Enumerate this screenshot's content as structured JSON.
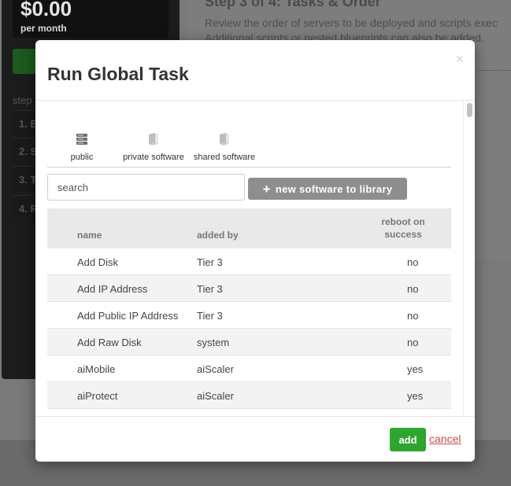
{
  "background": {
    "price": "$0.00",
    "price_period": "per month",
    "steps_label": "step",
    "steps": [
      "1. E",
      "2. S",
      "3. T",
      "4. R"
    ],
    "heading": "Step 3 of 4: Tasks & Order",
    "description_line1": "Review the order of servers to be deployed and scripts exec",
    "description_line2": "Additional scripts or nested blueprints can also be added."
  },
  "modal": {
    "title": "Run Global Task",
    "close_glyph": "×",
    "tabs": [
      {
        "label": "public",
        "icon": "server-stack-icon"
      },
      {
        "label": "private software",
        "icon": "package-icon"
      },
      {
        "label": "shared software",
        "icon": "package-icon"
      }
    ],
    "search": {
      "placeholder": "search",
      "value": ""
    },
    "new_software_button": {
      "icon": "plus-icon",
      "label": "new software to library"
    },
    "table": {
      "headers": [
        "name",
        "added by",
        "reboot on\nsuccess"
      ],
      "rows": [
        [
          "Add Disk",
          "Tier 3",
          "no"
        ],
        [
          "Add IP Address",
          "Tier 3",
          "no"
        ],
        [
          "Add Public IP Address",
          "Tier 3",
          "no"
        ],
        [
          "Add Raw Disk",
          "system",
          "no"
        ],
        [
          "aiMobile",
          "aiScaler",
          "yes"
        ],
        [
          "aiProtect",
          "aiScaler",
          "yes"
        ]
      ]
    },
    "footer": {
      "add_label": "add",
      "cancel_label": "cancel"
    }
  },
  "colors": {
    "accent_green": "#2ea52e",
    "cancel_red": "#d14b4b",
    "button_gray": "#8e8e8e"
  }
}
